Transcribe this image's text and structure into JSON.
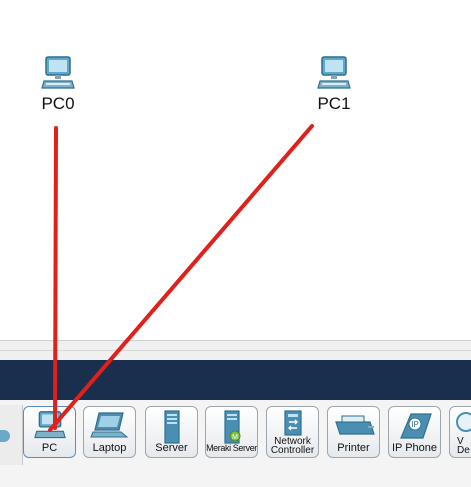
{
  "workspace": {
    "nodes": [
      {
        "label": "PC0",
        "icon": "pc-icon"
      },
      {
        "label": "PC1",
        "icon": "pc-icon"
      }
    ],
    "cable_color": "#e0201b"
  },
  "device_palette": {
    "items": [
      {
        "label": "PC",
        "icon": "pc-icon"
      },
      {
        "label": "Laptop",
        "icon": "laptop-icon"
      },
      {
        "label": "Server",
        "icon": "server-icon"
      },
      {
        "label": "Meraki Server",
        "icon": "meraki-server-icon"
      },
      {
        "label": "Network Controller",
        "line1": "Network",
        "line2": "Controller",
        "icon": "network-controller-icon"
      },
      {
        "label": "Printer",
        "icon": "printer-icon"
      },
      {
        "label": "IP Phone",
        "icon": "ip-phone-icon"
      },
      {
        "label": "Ve De",
        "line1": "V",
        "line2": "De",
        "icon": "partial-device-icon"
      }
    ]
  },
  "colors": {
    "toolbar_dark": "#1a2e4d",
    "icon_blue": "#4a8fb3"
  }
}
